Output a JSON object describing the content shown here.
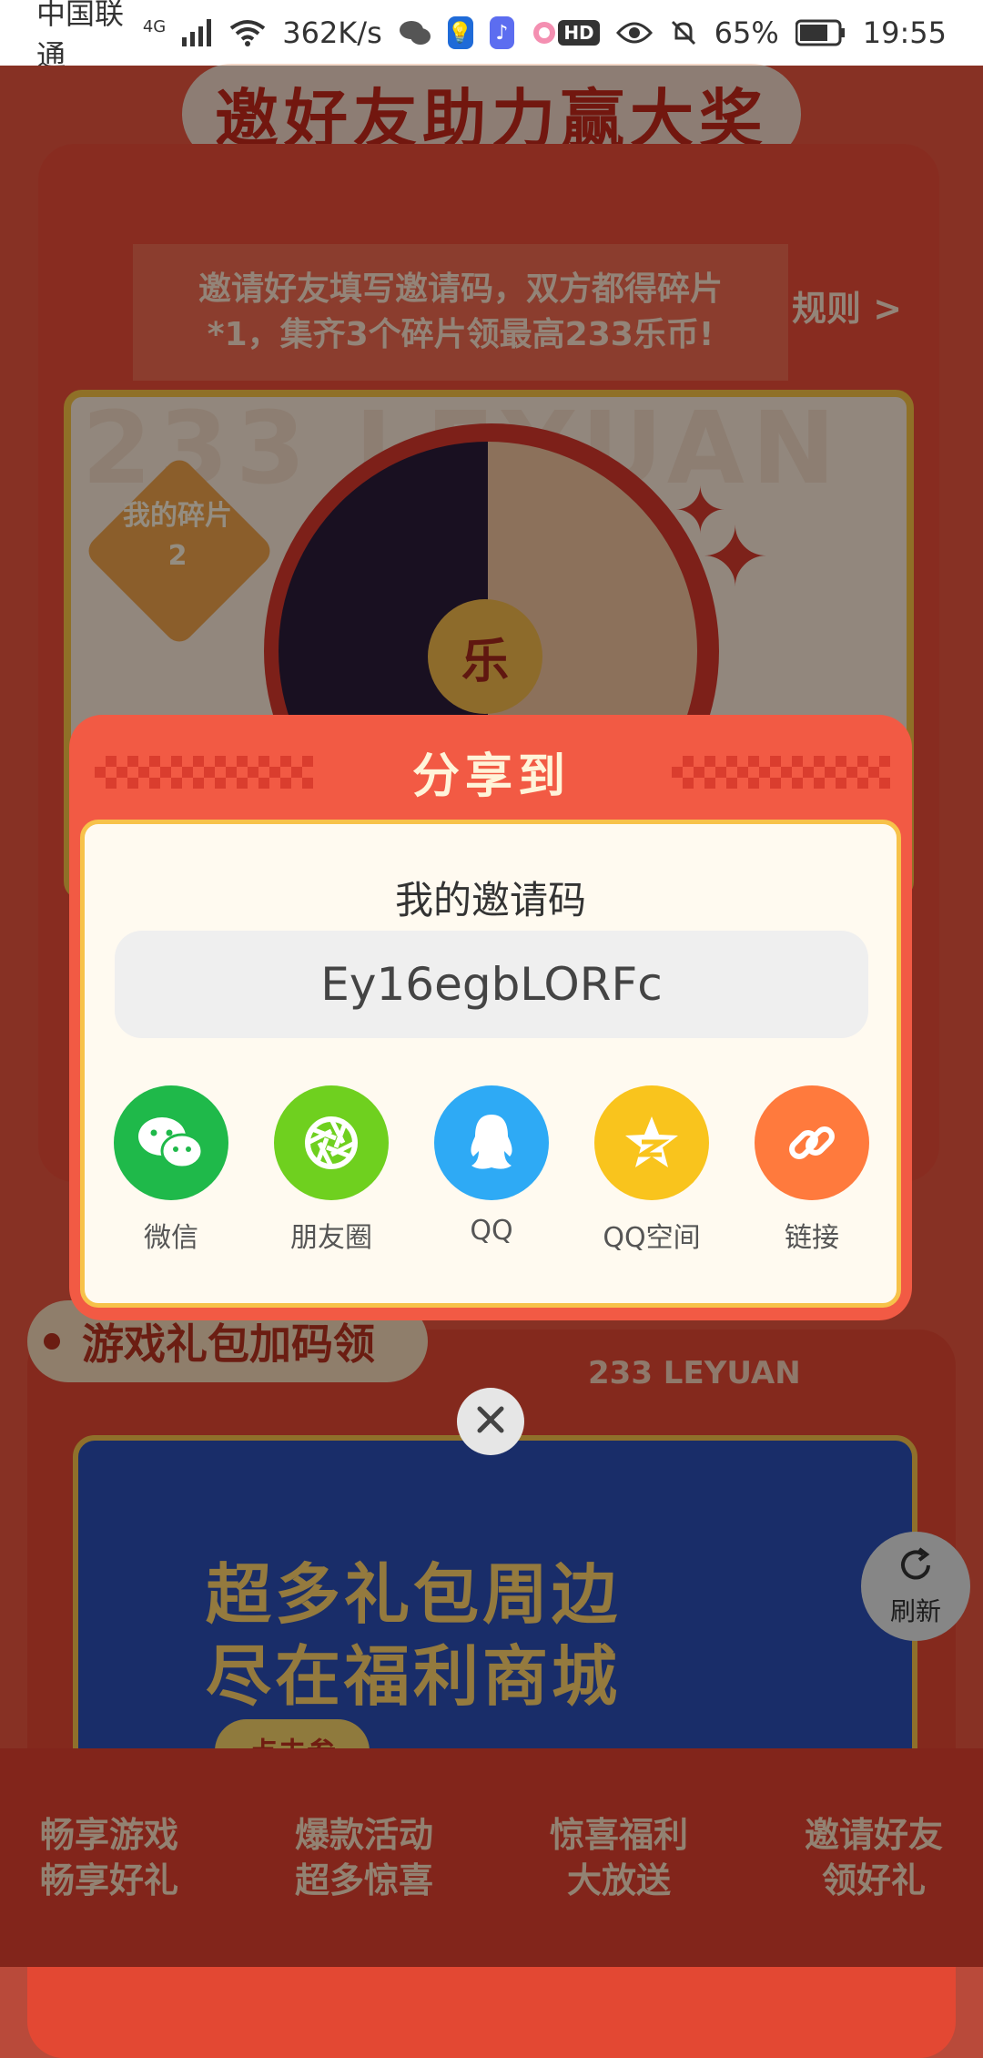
{
  "status_bar": {
    "carrier": "中国联通",
    "network": "4G",
    "speed": "362K/s",
    "hd": "HD",
    "battery": "65%",
    "time": "19:55"
  },
  "page": {
    "title": "邀好友助力赢大奖",
    "rule_text": "邀请好友填写邀请码，双方都得碎片*1，集齐3个碎片领最高233乐币!",
    "rule_link": "规则 >",
    "brand_watermark": "233 LEYUAN",
    "fragment_label": "我的碎片",
    "fragment_count": "2",
    "le_badge": "乐",
    "gift_section_title": "游戏礼包加码领",
    "brand_line": "233 LEYUAN",
    "banner_line1": "超多礼包周边",
    "banner_line2": "尽在福利商城",
    "banner_button": "点击参",
    "refresh": "刷新"
  },
  "bottom_nav": [
    {
      "line1": "畅享游戏",
      "line2": "畅享好礼"
    },
    {
      "line1": "爆款活动",
      "line2": "超多惊喜"
    },
    {
      "line1": "惊喜福利",
      "line2": "大放送"
    },
    {
      "line1": "邀请好友",
      "line2": "领好礼"
    }
  ],
  "modal": {
    "title": "分享到",
    "code_label": "我的邀请码",
    "code_value": "Ey16egbLORFc",
    "share_targets": [
      {
        "label": "微信",
        "icon": "wechat-icon",
        "color": "#1fb94a"
      },
      {
        "label": "朋友圈",
        "icon": "moments-icon",
        "color": "#6fd01f"
      },
      {
        "label": "QQ",
        "icon": "qq-icon",
        "color": "#2eaaf5"
      },
      {
        "label": "QQ空间",
        "icon": "qzone-icon",
        "color": "#f9c41d"
      },
      {
        "label": "链接",
        "icon": "link-icon",
        "color": "#ff7a3d"
      }
    ]
  }
}
